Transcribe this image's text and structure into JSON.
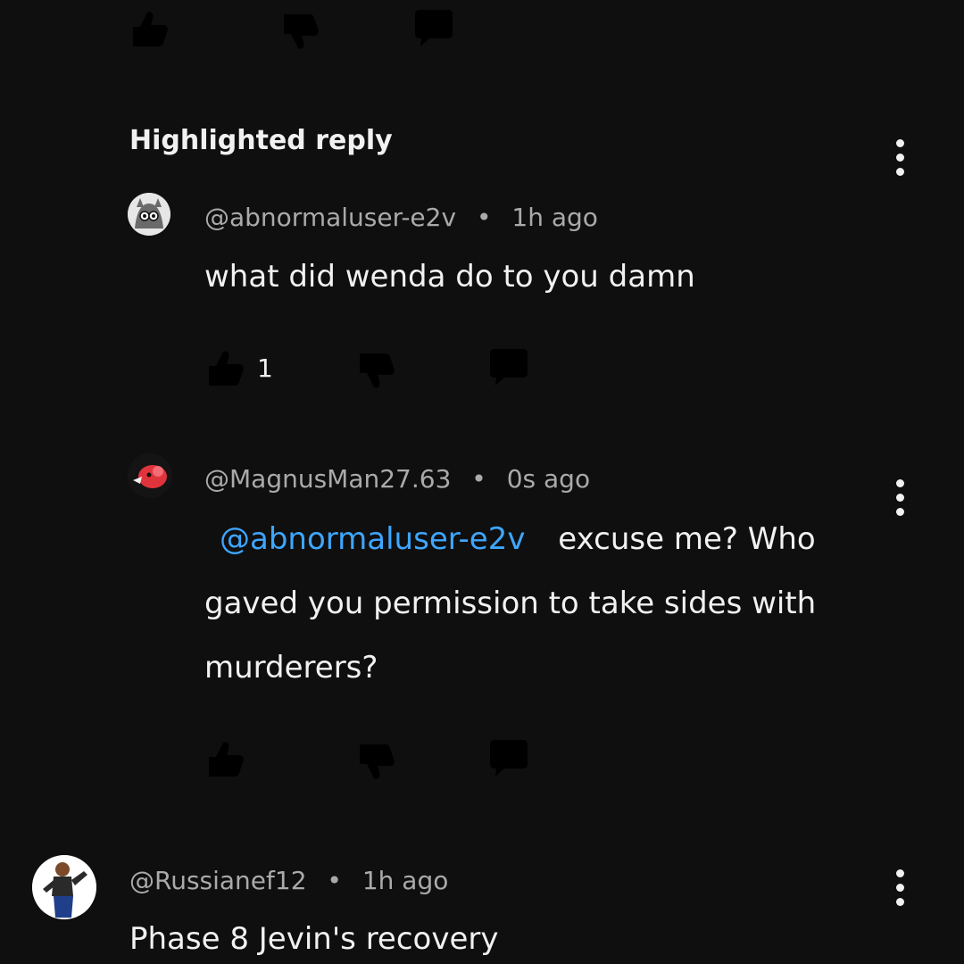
{
  "highlighted_label": "Highlighted reply",
  "comments": [
    {
      "handle": "@abnormaluser-e2v",
      "separator": "•",
      "time": "1h ago",
      "text": "what did wenda do to you damn",
      "like_count": "1"
    },
    {
      "handle": "@MagnusMan27.63",
      "separator": "•",
      "time": "0s ago",
      "mention": "@abnormaluser-e2v",
      "text_line1": "excuse me? Who",
      "text_line2": "gaved you permission to take sides with",
      "text_line3": "murderers?"
    },
    {
      "handle": "@Russianef12",
      "separator": "•",
      "time": "1h ago",
      "text": "Phase 8 Jevin's recovery"
    }
  ],
  "icons": {
    "like": "thumbs-up-icon",
    "dislike": "thumbs-down-icon",
    "reply": "reply-icon",
    "more": "more-options-icon"
  },
  "colors": {
    "background": "#0f0f0f",
    "text": "#f1f1f1",
    "meta": "#aaaaaa",
    "mention": "#3ea6ff"
  }
}
